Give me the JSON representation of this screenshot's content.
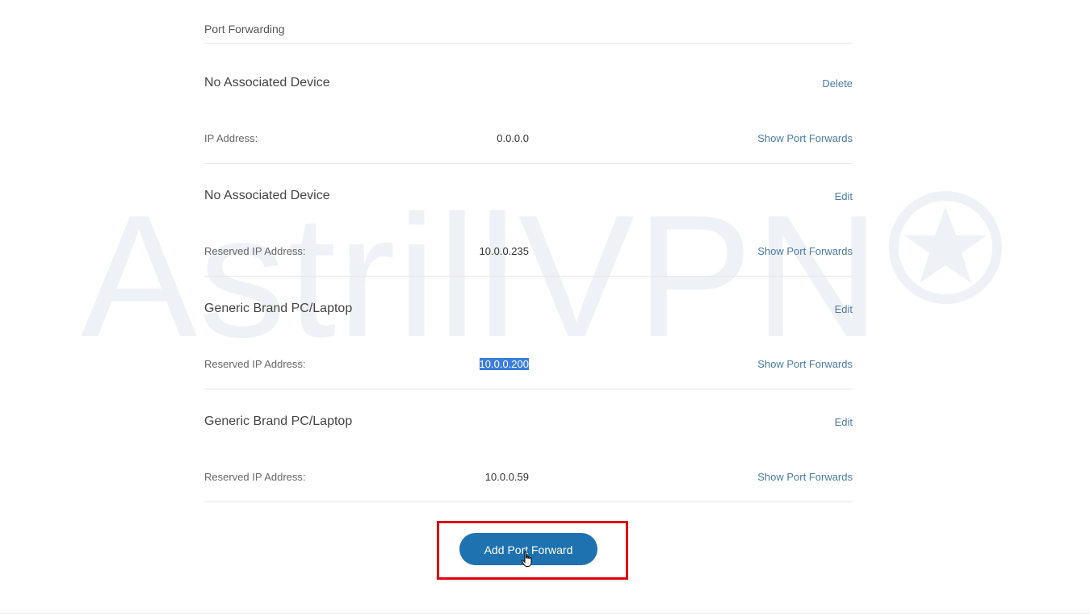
{
  "watermark": {
    "text": "AstrillVPN",
    "logo_icon": "star-circle-icon",
    "color": "#eef1f6"
  },
  "section": {
    "title": "Port Forwarding"
  },
  "entries": [
    {
      "name": "No Associated Device",
      "action": "Delete",
      "ip_label": "IP Address:",
      "ip_value": "0.0.0.0",
      "show_link": "Show Port Forwards"
    },
    {
      "name": "No Associated Device",
      "action": "Edit",
      "ip_label": "Reserved IP Address:",
      "ip_value": "10.0.0.235",
      "show_link": "Show Port Forwards"
    },
    {
      "name": "Generic Brand PC/Laptop",
      "action": "Edit",
      "ip_label": "Reserved IP Address:",
      "ip_value": "10.0.0.200",
      "ip_selected": true,
      "show_link": "Show Port Forwards"
    },
    {
      "name": "Generic Brand PC/Laptop",
      "action": "Edit",
      "ip_label": "Reserved IP Address:",
      "ip_value": "10.0.0.59",
      "show_link": "Show Port Forwards"
    }
  ],
  "add_button": {
    "label": "Add Port Forward"
  },
  "colors": {
    "link": "#4a7ba6",
    "button": "#1f72b0",
    "highlight_box": "#e0000f",
    "selection": "#3b7ddd"
  }
}
